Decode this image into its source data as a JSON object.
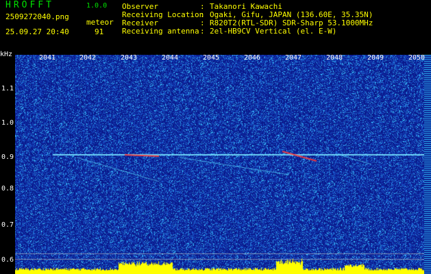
{
  "header": {
    "app_title": "HROFFT",
    "version": "1.0.0",
    "filename": "2509272040.png",
    "mode": "meteor",
    "timestamp": "25.09.27 20:40",
    "count": "91"
  },
  "info": [
    {
      "label": "Observer",
      "value": "Takanori Kawachi"
    },
    {
      "label": "Receiving Location",
      "value": "Ogaki, Gifu, JAPAN (136.60E, 35.35N)"
    },
    {
      "label": "Receiver",
      "value": "R820T2(RTL-SDR) SDR-Sharp 53.1000MHz"
    },
    {
      "label": "Receiving antenna",
      "value": "2el-HB9CV Vertical (el. E-W)"
    }
  ],
  "axes": {
    "unit": "kHz",
    "y_ticks": [
      "1.1",
      "1.0",
      "0.9",
      "0.8",
      "0.7",
      "0.6"
    ],
    "x_ticks": [
      "2041",
      "2042",
      "2043",
      "2044",
      "2045",
      "2046",
      "2047",
      "2048",
      "2049",
      "2050"
    ]
  },
  "colors": {
    "header_green": "#00e000",
    "header_yellow": "#ffff00",
    "background_blue": "#0a1a8c",
    "noise_cyan": "#33ccff",
    "signal_red": "#ff3030",
    "baseline_yellow": "#ffff00"
  }
}
